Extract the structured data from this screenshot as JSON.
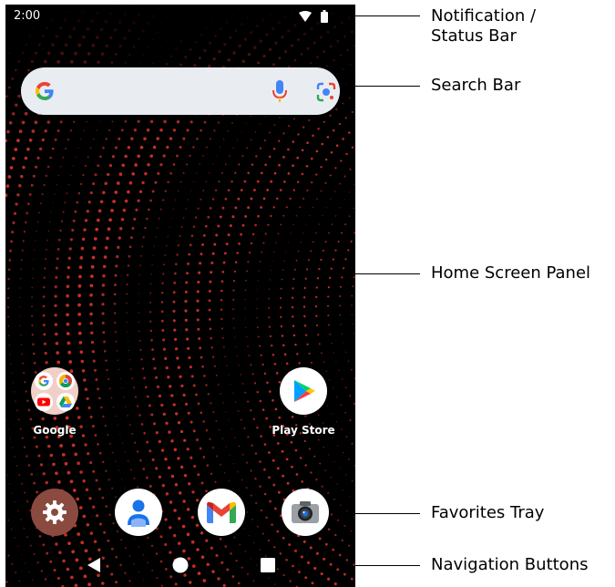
{
  "status_bar": {
    "time": "2:00"
  },
  "search_bar": {
    "logo_icon": "google-g-icon",
    "mic_icon": "microphone-icon",
    "lens_icon": "google-lens-icon"
  },
  "home_apps": [
    {
      "label": "Google",
      "icon": "google-folder-icon"
    },
    {
      "label": "Play Store",
      "icon": "play-store-icon"
    }
  ],
  "favorites_tray": [
    {
      "icon": "settings-gear-icon"
    },
    {
      "icon": "contacts-icon"
    },
    {
      "icon": "gmail-icon"
    },
    {
      "icon": "camera-icon"
    }
  ],
  "nav_buttons": [
    {
      "icon": "back-triangle-icon"
    },
    {
      "icon": "home-circle-icon"
    },
    {
      "icon": "recents-square-icon"
    }
  ],
  "callouts": {
    "status_bar_line1": "Notification /",
    "status_bar_line2": "Status Bar",
    "search_bar": "Search Bar",
    "home_screen_panel": "Home Screen Panel",
    "favorites_tray": "Favorites Tray",
    "navigation_buttons": "Navigation Buttons"
  },
  "colors": {
    "wallpaper_bg": "#000000",
    "wallpaper_dots": "#d0322a",
    "search_bar_bg": "#e9edf2",
    "settings_bg": "#8a4a40"
  }
}
